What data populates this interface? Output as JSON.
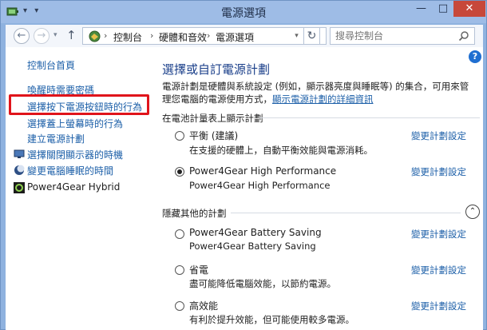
{
  "window": {
    "title": "電源選項",
    "quick_access": "▾ ▾",
    "minimize": "—",
    "maximize": "□",
    "close": "✕"
  },
  "address": {
    "back_icon": "←",
    "forward_icon": "→",
    "dropdown_icon": "▾",
    "up_icon": "↑",
    "breadcrumb": [
      "控制台",
      "硬體和音效",
      "電源選項"
    ],
    "separator": "›",
    "refresh_icon": "↻",
    "search_placeholder": "搜尋控制台"
  },
  "sidebar": {
    "home": "控制台首頁",
    "links": [
      "喚醒時需要密碼",
      "選擇按下電源按鈕時的行為",
      "選擇蓋上螢幕時的行為",
      "建立電源計劃",
      "選擇關閉顯示器的時機",
      "變更電腦睡眠的時間"
    ],
    "highlighted_index": 1,
    "extra_item": "Power4Gear Hybrid"
  },
  "main": {
    "help": "?",
    "title": "選擇或自訂電源計劃",
    "description_part1": "電源計劃是硬體與系統設定 (例如，顯示器亮度與睡眠等) 的集合，可用來管理您電腦的電源使用方式，",
    "description_link": "顯示電源計劃的詳細資訊",
    "section1": "在電池計量表上顯示計劃",
    "section2": "隱藏其他的計劃",
    "collapse_icon": "⌃",
    "change_label": "變更計劃設定",
    "plans": [
      {
        "name": "平衡 (建議)",
        "desc": "在支援的硬體上，自動平衡效能與電源消耗。",
        "checked": false
      },
      {
        "name": "Power4Gear High Performance",
        "desc": "Power4Gear High Performance",
        "checked": true
      },
      {
        "name": "Power4Gear Battery Saving",
        "desc": "Power4Gear Battery Saving",
        "checked": false
      },
      {
        "name": "省電",
        "desc": "盡可能降低電腦效能，以節約電源。",
        "checked": false
      },
      {
        "name": "高效能",
        "desc": "有利於提升效能，但可能使用較多電源。",
        "checked": false
      }
    ]
  },
  "colors": {
    "highlight_border": "#e0141b",
    "link": "#1c5fa8",
    "title": "#1a3f8a"
  }
}
